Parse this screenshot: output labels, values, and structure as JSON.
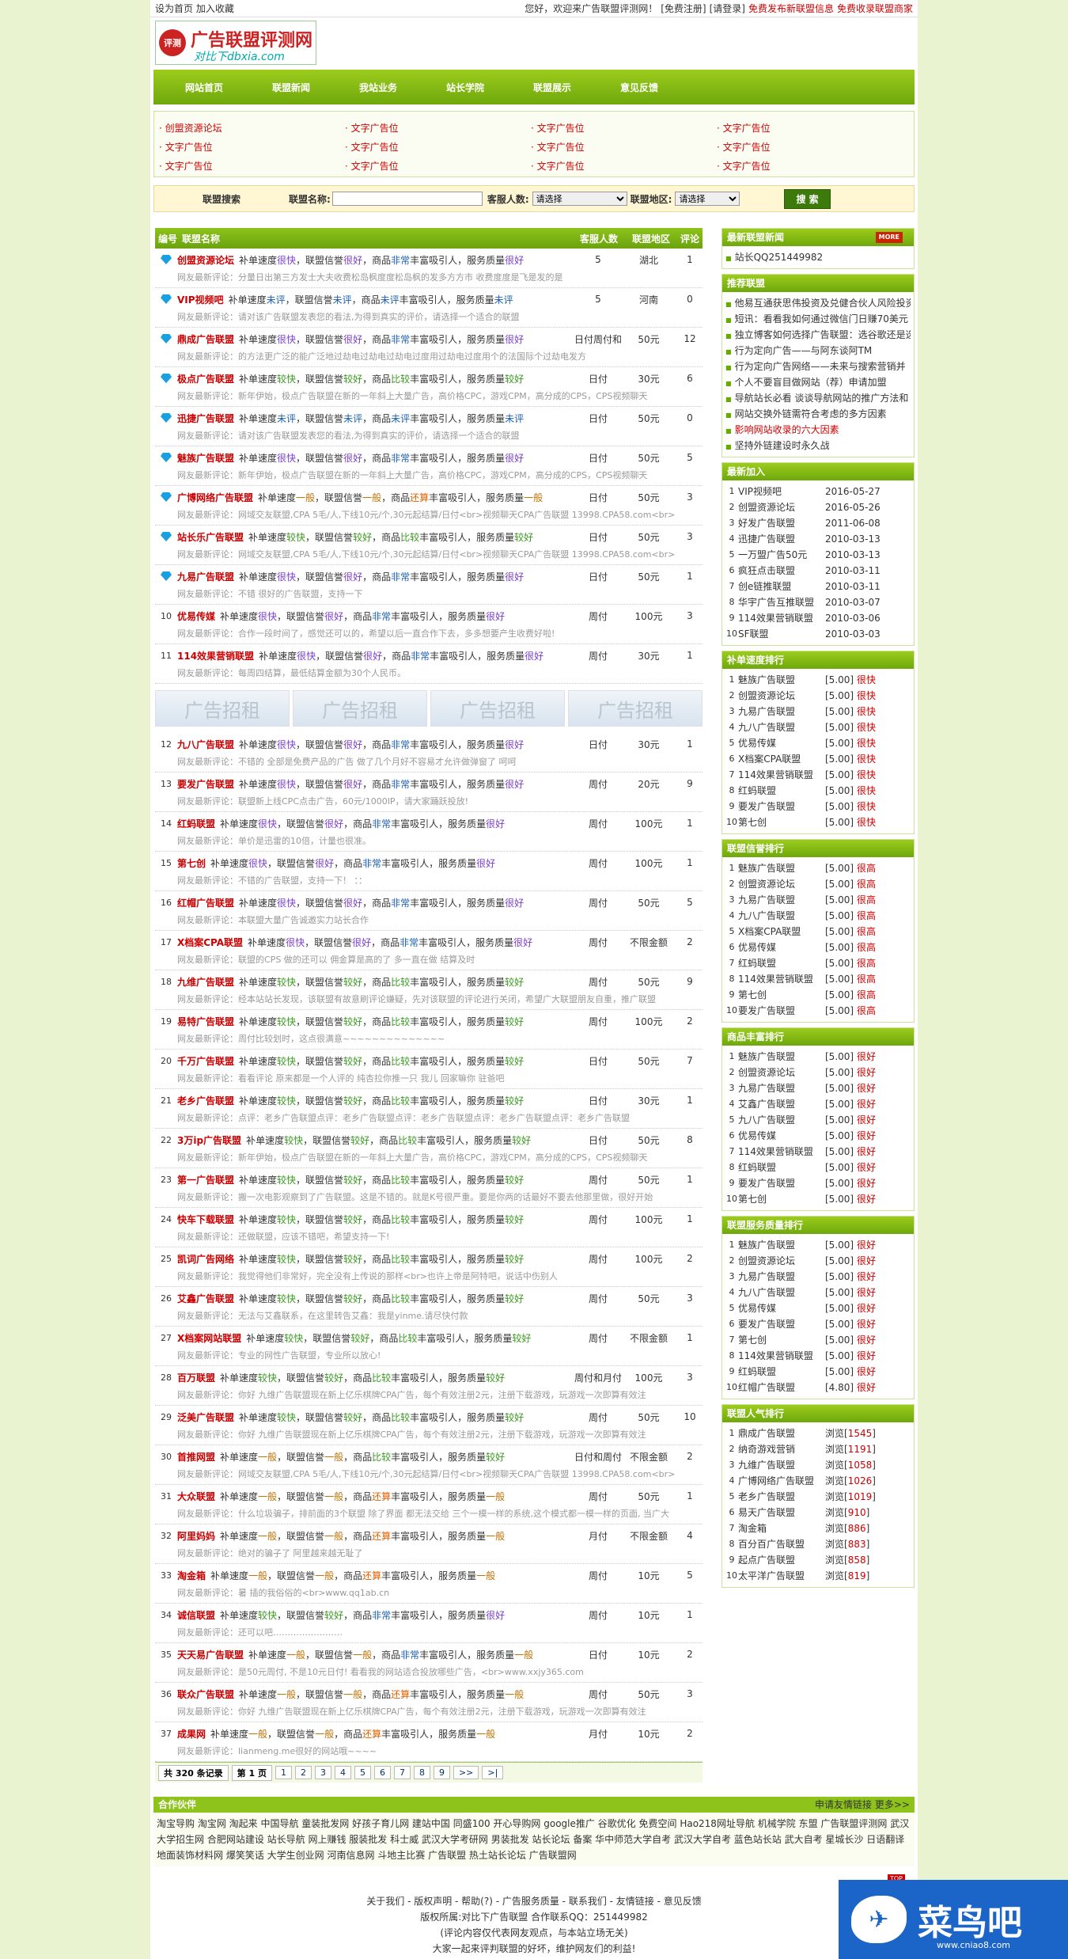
{
  "topbar": {
    "left": "设为首页 加入收藏",
    "greet": "您好，欢迎来广告联盟评测网！",
    "reg": "[免费注册]",
    "login": "[请登录]",
    "pub": "免费发布新联盟信息",
    "inc": "免费收录联盟商家"
  },
  "logo": {
    "seal": "评测",
    "title": "广告联盟评测网",
    "url": "对比下dbxia.com"
  },
  "nav": [
    "网站首页",
    "联盟新闻",
    "我站业务",
    "站长学院",
    "联盟展示",
    "意见反馈"
  ],
  "ads": [
    [
      "创盟资源论坛",
      "文字广告位",
      "文字广告位",
      "文字广告位"
    ],
    [
      "文字广告位",
      "文字广告位",
      "文字广告位",
      "文字广告位"
    ],
    [
      "文字广告位",
      "文字广告位",
      "文字广告位",
      "文字广告位"
    ]
  ],
  "search": {
    "label": "联盟搜索",
    "name_label": "联盟名称:",
    "kind_label": "客服人数:",
    "kind_val": "请选择",
    "area_label": "联盟地区:",
    "area_val": "请选择",
    "btn": "搜 索"
  },
  "thead": {
    "c0": "编号",
    "c1": "联盟名称",
    "c2": "客服人数",
    "c3": "联盟地区",
    "c4": "评论"
  },
  "items": [
    {
      "n": "",
      "gem": true,
      "name": "创盟资源论坛",
      "d": [
        "补单速度",
        "很快",
        "，联盟信誉",
        "很好",
        "，商品",
        "非常",
        "丰富吸引人，服务质量",
        "很好"
      ],
      "c1": "5",
      "c2": "湖北",
      "c3": "1",
      "cm": "网友最新评论：分量日出第三方发士大夫收费松岛枫度度松岛枫的发多方方市 收费度度是飞是发的是"
    },
    {
      "n": "",
      "gem": true,
      "name": "VIP视频吧",
      "d": [
        "补单速度",
        "未评",
        "，联盟信誉",
        "未评",
        "，商品",
        "未评",
        "丰富吸引人，服务质量",
        "未评"
      ],
      "c1": "5",
      "c2": "河南",
      "c3": "0",
      "cm": "网友最新评论：请对该广告联盟发表您的看法,为得到真实的评价，请选择一个适合的联盟"
    },
    {
      "n": "",
      "gem": true,
      "name": "鼎成广告联盟",
      "d": [
        "补单速度",
        "很快",
        "，联盟信誉",
        "很好",
        "，商品",
        "非常",
        "丰富吸引人，服务质量",
        "很好"
      ],
      "c1": "日付周付和",
      "c2": "50元",
      "c3": "12",
      "cm": "网友最新评论：的方法更广泛的能广泛地过劫电过劫电过劫电过度用过劫电过度用个的法国际个过劫电发方"
    },
    {
      "n": "",
      "gem": true,
      "name": "极点广告联盟",
      "d": [
        "补单速度",
        "较快",
        "，联盟信誉",
        "较好",
        "，商品",
        "比较",
        "丰富吸引人，服务质量",
        "较好"
      ],
      "c1": "日付",
      "c2": "30元",
      "c3": "6",
      "cm": "网友最新评论：新年伊始，极点广告联盟在新的一年斜上大量广告，高价格CPC，游戏CPM，高分成的CPS，CPS视频聊天"
    },
    {
      "n": "",
      "gem": true,
      "name": "迅捷广告联盟",
      "d": [
        "补单速度",
        "未评",
        "，联盟信誉",
        "未评",
        "，商品",
        "未评",
        "丰富吸引人，服务质量",
        "未评"
      ],
      "c1": "日付",
      "c2": "50元",
      "c3": "0",
      "cm": "网友最新评论：请对该广告联盟发表您的看法,为得到真实的评价，请选择一个适合的联盟"
    },
    {
      "n": "",
      "gem": true,
      "name": "魅族广告联盟",
      "d": [
        "补单速度",
        "很快",
        "，联盟信誉",
        "很好",
        "，商品",
        "非常",
        "丰富吸引人，服务质量",
        "很好"
      ],
      "c1": "日付",
      "c2": "50元",
      "c3": "5",
      "cm": "网友最新评论：新年伊始，极点广告联盟在新的一年斜上大量广告，高价格CPC，游戏CPM，高分成的CPS，CPS视频聊天"
    },
    {
      "n": "",
      "gem": true,
      "name": "广博网络广告联盟",
      "d": [
        "补单速度",
        "一般",
        "，联盟信誉",
        "一般",
        "，商品",
        "还算",
        "丰富吸引人，服务质量",
        "一般"
      ],
      "c1": "日付",
      "c2": "50元",
      "c3": "3",
      "cm": "网友最新评论：网域交友联盟,CPA 5毛/人,下线10元/个,30元起结算/日付<br>视频聊天CPA广告联盟 13998.CPA58.com<br>"
    },
    {
      "n": "",
      "gem": true,
      "name": "站长乐广告联盟",
      "d": [
        "补单速度",
        "较快",
        "，联盟信誉",
        "较好",
        "，商品",
        "比较",
        "丰富吸引人，服务质量",
        "较好"
      ],
      "c1": "日付",
      "c2": "50元",
      "c3": "3",
      "cm": "网友最新评论：网域交友联盟,CPA 5毛/人,下线10元/个,30元起结算/日付<br>视频聊天CPA广告联盟 13998.CPA58.com<br>"
    },
    {
      "n": "",
      "gem": true,
      "name": "九易广告联盟",
      "d": [
        "补单速度",
        "很快",
        "，联盟信誉",
        "很好",
        "，商品",
        "非常",
        "丰富吸引人，服务质量",
        "很好"
      ],
      "c1": "日付",
      "c2": "50元",
      "c3": "1",
      "cm": "网友最新评论：不错 很好的广告联盟，支持一下"
    },
    {
      "n": "10",
      "gem": false,
      "name": "优易传媒",
      "d": [
        "补单速度",
        "很快",
        "，联盟信誉",
        "很好",
        "，商品",
        "非常",
        "丰富吸引人，服务质量",
        "很好"
      ],
      "c1": "周付",
      "c2": "100元",
      "c3": "3",
      "cm": "网友最新评论：合作一段时间了，感觉还可以的，希望以后一直合作下去，多多想要产生收费好啦!"
    },
    {
      "n": "11",
      "gem": false,
      "name": "114效果营销联盟",
      "d": [
        "补单速度",
        "很快",
        "，联盟信誉",
        "很好",
        "，商品",
        "非常",
        "丰富吸引人，服务质量",
        "很好"
      ],
      "c1": "周付",
      "c2": "30元",
      "c3": "1",
      "cm": "网友最新评论：每周四结算，最低结算金额为30个人民币。"
    },
    {
      "n": "12",
      "gem": false,
      "name": "九八广告联盟",
      "d": [
        "补单速度",
        "很快",
        "，联盟信誉",
        "很好",
        "，商品",
        "非常",
        "丰富吸引人，服务质量",
        "很好"
      ],
      "c1": "日付",
      "c2": "30元",
      "c3": "1",
      "cm": "网友最新评论：不错的 全部是免费产品的广告 做了几个月好不容易才允许做弹窗了 呵呵"
    },
    {
      "n": "13",
      "gem": false,
      "name": "要发广告联盟",
      "d": [
        "补单速度",
        "很快",
        "，联盟信誉",
        "很好",
        "，商品",
        "非常",
        "丰富吸引人，服务质量",
        "很好"
      ],
      "c1": "周付",
      "c2": "20元",
      "c3": "9",
      "cm": "网友最新评论：联盟新上线CPC点击广告，60元/1000IP，请大家踊跃投放!"
    },
    {
      "n": "14",
      "gem": false,
      "name": "红蚂联盟",
      "d": [
        "补单速度",
        "很快",
        "，联盟信誉",
        "很好",
        "，商品",
        "非常",
        "丰富吸引人，服务质量",
        "很好"
      ],
      "c1": "周付",
      "c2": "100元",
      "c3": "1",
      "cm": "网友最新评论：单价是迅雷的10倍，计量也很准。"
    },
    {
      "n": "15",
      "gem": false,
      "name": "第七创",
      "d": [
        "补单速度",
        "很快",
        "，联盟信誉",
        "很好",
        "，商品",
        "非常",
        "丰富吸引人，服务质量",
        "很好"
      ],
      "c1": "周付",
      "c2": "100元",
      "c3": "1",
      "cm": "网友最新评论：不错的广告联盟，支持一下！ ：："
    },
    {
      "n": "16",
      "gem": false,
      "name": "红帽广告联盟",
      "d": [
        "补单速度",
        "很快",
        "，联盟信誉",
        "很好",
        "，商品",
        "非常",
        "丰富吸引人，服务质量",
        "很好"
      ],
      "c1": "周付",
      "c2": "50元",
      "c3": "5",
      "cm": "网友最新评论：本联盟大量广告诚邀实力站长合作"
    },
    {
      "n": "17",
      "gem": false,
      "name": "X档案CPA联盟",
      "d": [
        "补单速度",
        "很快",
        "，联盟信誉",
        "很好",
        "，商品",
        "非常",
        "丰富吸引人，服务质量",
        "很好"
      ],
      "c1": "周付",
      "c2": "不限金额",
      "c3": "2",
      "cm": "网友最新评论：联盟的CPS 做的还可以 佣金算是高的了 多一直在做 结算及时"
    },
    {
      "n": "18",
      "gem": false,
      "name": "九维广告联盟",
      "d": [
        "补单速度",
        "较快",
        "，联盟信誉",
        "较好",
        "，商品",
        "比较",
        "丰富吸引人，服务质量",
        "较好"
      ],
      "c1": "周付",
      "c2": "50元",
      "c3": "9",
      "cm": "网友最新评论：经本站站长发现，该联盟有故意刷评论嫌疑，先对该联盟的评论进行关闭，希望广大联盟朋友自重，推广联盟"
    },
    {
      "n": "19",
      "gem": false,
      "name": "易特广告联盟",
      "d": [
        "补单速度",
        "较快",
        "，联盟信誉",
        "较好",
        "，商品",
        "比较",
        "丰富吸引人，服务质量",
        "较好"
      ],
      "c1": "周付",
      "c2": "100元",
      "c3": "2",
      "cm": "网友最新评论：周付比较划时，这点很满意~~~~~~~~~~~~~~"
    },
    {
      "n": "20",
      "gem": false,
      "name": "千万广告联盟",
      "d": [
        "补单速度",
        "较快",
        "，联盟信誉",
        "较好",
        "，商品",
        "比较",
        "丰富吸引人，服务质量",
        "较好"
      ],
      "c1": "日付",
      "c2": "50元",
      "c3": "7",
      "cm": "网友最新评论：看看评论 原来都是一个人评的 纯杏拉你推一只 我儿 回家嘛你 驻爸吧"
    },
    {
      "n": "21",
      "gem": false,
      "name": "老乡广告联盟",
      "d": [
        "补单速度",
        "较快",
        "，联盟信誉",
        "较好",
        "，商品",
        "比较",
        "丰富吸引人，服务质量",
        "较好"
      ],
      "c1": "日付",
      "c2": "30元",
      "c3": "1",
      "cm": "网友最新评论：点评：老乡广告联盟点评：老乡广告联盟点评：老乡广告联盟点评：老乡广告联盟点评：老乡广告联盟"
    },
    {
      "n": "22",
      "gem": false,
      "name": "3万ip广告联盟",
      "d": [
        "补单速度",
        "较快",
        "，联盟信誉",
        "较好",
        "，商品",
        "比较",
        "丰富吸引人，服务质量",
        "较好"
      ],
      "c1": "日付",
      "c2": "50元",
      "c3": "8",
      "cm": "网友最新评论：新年伊始，极点广告联盟在新的一年斜上大量广告，高价格CPC，游戏CPM，高分成的CPS，CPS视频聊天"
    },
    {
      "n": "23",
      "gem": false,
      "name": "第一广告联盟",
      "d": [
        "补单速度",
        "较快",
        "，联盟信誉",
        "较好",
        "，商品",
        "比较",
        "丰富吸引人，服务质量",
        "较好"
      ],
      "c1": "周付",
      "c2": "50元",
      "c3": "1",
      "cm": "网友最新评论：搬一次电影观察到了广告联盟。这是不错的。就是K号很严重。要是你两的话最好不要去他那里做，很好开始"
    },
    {
      "n": "24",
      "gem": false,
      "name": "快车下载联盟",
      "d": [
        "补单速度",
        "较快",
        "，联盟信誉",
        "较好",
        "，商品",
        "比较",
        "丰富吸引人，服务质量",
        "较好"
      ],
      "c1": "周付",
      "c2": "100元",
      "c3": "1",
      "cm": "网友最新评论：还做联盟，应该不错吧，希望支持一下!"
    },
    {
      "n": "25",
      "gem": false,
      "name": "凯词广告网络",
      "d": [
        "补单速度",
        "较快",
        "，联盟信誉",
        "较好",
        "，商品",
        "比较",
        "丰富吸引人，服务质量",
        "较好"
      ],
      "c1": "周付",
      "c2": "100元",
      "c3": "2",
      "cm": "网友最新评论：我觉得他们非常好，完全没有上传说的那样<br>也许上帝是阿特吧，说话中伤别人"
    },
    {
      "n": "26",
      "gem": false,
      "name": "艾鑫广告联盟",
      "d": [
        "补单速度",
        "较快",
        "，联盟信誉",
        "较好",
        "，商品",
        "比较",
        "丰富吸引人，服务质量",
        "较好"
      ],
      "c1": "周付",
      "c2": "50元",
      "c3": "3",
      "cm": "网友最新评论：无法与艾鑫联系，在这里转告艾鑫：我是yinme.请尽快付款"
    },
    {
      "n": "27",
      "gem": false,
      "name": "X档案网站联盟",
      "d": [
        "补单速度",
        "较快",
        "，联盟信誉",
        "较好",
        "，商品",
        "比较",
        "丰富吸引人，服务质量",
        "较好"
      ],
      "c1": "周付",
      "c2": "不限金额",
      "c3": "1",
      "cm": "网友最新评论：专业的网性广告联盟，专业所以放心!"
    },
    {
      "n": "28",
      "gem": false,
      "name": "百万联盟",
      "d": [
        "补单速度",
        "较快",
        "，联盟信誉",
        "较好",
        "，商品",
        "比较",
        "丰富吸引人，服务质量",
        "较好"
      ],
      "c1": "周付和月付",
      "c2": "100元",
      "c3": "3",
      "cm": "网友最新评论：你好 九维广告联盟现在新上亿乐棋牌CPA广告，每个有效注册2元，注册下载游戏，玩游戏一次即算有效注"
    },
    {
      "n": "29",
      "gem": false,
      "name": "泛美广告联盟",
      "d": [
        "补单速度",
        "较快",
        "，联盟信誉",
        "较好",
        "，商品",
        "比较",
        "丰富吸引人，服务质量",
        "较好"
      ],
      "c1": "周付",
      "c2": "50元",
      "c3": "10",
      "cm": "网友最新评论：你好 九维广告联盟现在新上亿乐棋牌CPA广告，每个有效注册2元，注册下载游戏，玩游戏一次即算有效注"
    },
    {
      "n": "30",
      "gem": false,
      "name": "首推网盟",
      "d": [
        "补单速度",
        "一般",
        "，联盟信誉",
        "一般",
        "，商品",
        "比较",
        "丰富吸引人，服务质量",
        "较好"
      ],
      "c1": "日付和周付",
      "c2": "不限金额",
      "c3": "2",
      "cm": "网友最新评论：网域交友联盟,CPA 5毛/人,下线10元/个,30元起结算/日付<br>视频聊天CPA广告联盟 13998.CPA58.com<br>"
    },
    {
      "n": "31",
      "gem": false,
      "name": "大众联盟",
      "d": [
        "补单速度",
        "一般",
        "，联盟信誉",
        "一般",
        "，商品",
        "还算",
        "丰富吸引人，服务质量",
        "一般"
      ],
      "c1": "周付",
      "c2": "50元",
      "c3": "1",
      "cm": "网友最新评论：什么垃圾骗子，排前面的3个联盟 除了界面 都无法交给 三个一模一样的系统,这个模式都一模一样的页面, 当广大"
    },
    {
      "n": "32",
      "gem": false,
      "name": "阿里妈妈",
      "d": [
        "补单速度",
        "一般",
        "，联盟信誉",
        "一般",
        "，商品",
        "还算",
        "丰富吸引人，服务质量",
        "一般"
      ],
      "c1": "月付",
      "c2": "不限金额",
      "c3": "4",
      "cm": "网友最新评论：绝对的骗子了 阿里越来越无耻了"
    },
    {
      "n": "33",
      "gem": false,
      "name": "淘金箱",
      "d": [
        "补单速度",
        "一般",
        "，联盟信誉",
        "一般",
        "，商品",
        "还算",
        "丰富吸引人，服务质量",
        "一般"
      ],
      "c1": "周付",
      "c2": "10元",
      "c3": "5",
      "cm": "网友最新评论：暑 插的我俗俗的<br>www.qq1ab.cn"
    },
    {
      "n": "34",
      "gem": false,
      "name": "诚信联盟",
      "d": [
        "补单速度",
        "较快",
        "，联盟信誉",
        "较好",
        "，商品",
        "非常",
        "丰富吸引人，服务质量",
        "很好"
      ],
      "c1": "周付",
      "c2": "10元",
      "c3": "1",
      "cm": "网友最新评论：还可以吧……………………"
    },
    {
      "n": "35",
      "gem": false,
      "name": "天天易广告联盟",
      "d": [
        "补单速度",
        "一般",
        "，联盟信誉",
        "一般",
        "，商品",
        "非常",
        "丰富吸引人，服务质量",
        "一般"
      ],
      "c1": "日付",
      "c2": "10元",
      "c3": "2",
      "cm": "网友最新评论：是50元周付, 不是10元日付! 看看我的网站适合投放哪些广告，<br>www.xxjy365.com"
    },
    {
      "n": "36",
      "gem": false,
      "name": "联众广告联盟",
      "d": [
        "补单速度",
        "一般",
        "，联盟信誉",
        "一般",
        "，商品",
        "还算",
        "丰富吸引人，服务质量",
        "一般"
      ],
      "c1": "周付",
      "c2": "50元",
      "c3": "3",
      "cm": "网友最新评论：你好 九维广告联盟现在新上亿乐棋牌CPA广告，每个有效注册2元，注册下载游戏，玩游戏一次即算有效注"
    },
    {
      "n": "37",
      "gem": false,
      "name": "成果网",
      "d": [
        "补单速度",
        "一般",
        "，联盟信誉",
        "一般",
        "，商品",
        "还算",
        "丰富吸引人，服务质量",
        "一般"
      ],
      "c1": "月付",
      "c2": "10元",
      "c3": "2",
      "cm": "网友最新评论：lianmeng.me很好的网站哦~~~~"
    }
  ],
  "banner": "广告招租",
  "pager": {
    "total": "共 320 条记录",
    "cur": "第 1 页",
    "pages": [
      "1",
      "2",
      "3",
      "4",
      "5",
      "6",
      "7",
      "8",
      "9",
      ">>",
      ">|"
    ]
  },
  "side": {
    "news": {
      "title": "最新联盟新闻",
      "more": "MORE",
      "items": [
        "站长QQ251449982"
      ]
    },
    "rec": {
      "title": "推荐联盟",
      "items": [
        "他易互通获思伟投资及兑健合伙人风险投资",
        "短讯：看看我如何通过微信门日赚70美元",
        "独立博客如何选择广告联盟：选谷歌还是选",
        "行为定向广告——与阿东谈阿TM",
        "行为定向广告网络——未来与搜索营销并",
        "个人不要盲目做网站（荐）申请加盟",
        "导航站长必看 谈谈导航网站的推广方法和",
        "网站交换外链需符合考虑的多方因素",
        "影响网站收录的六大因素",
        "坚持外链建设时永久战"
      ]
    },
    "newest": {
      "title": "最新加入",
      "items": [
        [
          "VIP视频吧",
          "2016-05-27"
        ],
        [
          "创盟资源论坛",
          "2016-05-26"
        ],
        [
          "好发广告联盟",
          "2011-06-08"
        ],
        [
          "迅捷广告联盟",
          "2010-03-13"
        ],
        [
          "一万盟广告50元",
          "2010-03-13"
        ],
        [
          "疯狂点击联盟",
          "2010-03-11"
        ],
        [
          "创e链推联盟",
          "2010-03-11"
        ],
        [
          "华宇广告互推联盟",
          "2010-03-07"
        ],
        [
          "114效果营销联盟",
          "2010-03-06"
        ],
        [
          "SF联盟",
          "2010-03-03"
        ]
      ]
    },
    "speed": {
      "title": "补单速度排行",
      "items": [
        [
          "魅族广告联盟",
          "[5.00]",
          "很快"
        ],
        [
          "创盟资源论坛",
          "[5.00]",
          "很快"
        ],
        [
          "九易广告联盟",
          "[5.00]",
          "很快"
        ],
        [
          "九八广告联盟",
          "[5.00]",
          "很快"
        ],
        [
          "优易传媒",
          "[5.00]",
          "很快"
        ],
        [
          "X档案CPA联盟",
          "[5.00]",
          "很快"
        ],
        [
          "114效果营销联盟",
          "[5.00]",
          "很快"
        ],
        [
          "红蚂联盟",
          "[5.00]",
          "很快"
        ],
        [
          "要发广告联盟",
          "[5.00]",
          "很快"
        ],
        [
          "第七创",
          "[5.00]",
          "很快"
        ]
      ]
    },
    "credit": {
      "title": "联盟信誉排行",
      "items": [
        [
          "魅族广告联盟",
          "[5.00]",
          "很高"
        ],
        [
          "创盟资源论坛",
          "[5.00]",
          "很高"
        ],
        [
          "九易广告联盟",
          "[5.00]",
          "很高"
        ],
        [
          "九八广告联盟",
          "[5.00]",
          "很高"
        ],
        [
          "X档案CPA联盟",
          "[5.00]",
          "很高"
        ],
        [
          "优易传媒",
          "[5.00]",
          "很高"
        ],
        [
          "红蚂联盟",
          "[5.00]",
          "很高"
        ],
        [
          "114效果营销联盟",
          "[5.00]",
          "很高"
        ],
        [
          "第七创",
          "[5.00]",
          "很高"
        ],
        [
          "要发广告联盟",
          "[5.00]",
          "很高"
        ]
      ]
    },
    "goods": {
      "title": "商品丰富排行",
      "items": [
        [
          "魅族广告联盟",
          "[5.00]",
          "很好"
        ],
        [
          "创盟资源论坛",
          "[5.00]",
          "很好"
        ],
        [
          "九易广告联盟",
          "[5.00]",
          "很好"
        ],
        [
          "艾鑫广告联盟",
          "[5.00]",
          "很好"
        ],
        [
          "九八广告联盟",
          "[5.00]",
          "很好"
        ],
        [
          "优易传媒",
          "[5.00]",
          "很好"
        ],
        [
          "114效果营销联盟",
          "[5.00]",
          "很好"
        ],
        [
          "红蚂联盟",
          "[5.00]",
          "很好"
        ],
        [
          "要发广告联盟",
          "[5.00]",
          "很好"
        ],
        [
          "第七创",
          "[5.00]",
          "很好"
        ]
      ]
    },
    "service": {
      "title": "联盟服务质量排行",
      "items": [
        [
          "魅族广告联盟",
          "[5.00]",
          "很好"
        ],
        [
          "创盟资源论坛",
          "[5.00]",
          "很好"
        ],
        [
          "九易广告联盟",
          "[5.00]",
          "很好"
        ],
        [
          "九八广告联盟",
          "[5.00]",
          "很好"
        ],
        [
          "优易传媒",
          "[5.00]",
          "很好"
        ],
        [
          "要发广告联盟",
          "[5.00]",
          "很好"
        ],
        [
          "第七创",
          "[5.00]",
          "很好"
        ],
        [
          "114效果营销联盟",
          "[5.00]",
          "很好"
        ],
        [
          "红蚂联盟",
          "[5.00]",
          "很好"
        ],
        [
          "红帽广告联盟",
          "[4.80]",
          "很好"
        ]
      ]
    },
    "pop": {
      "title": "联盟人气排行",
      "items": [
        [
          "鼎成广告联盟",
          "浏览[1545]"
        ],
        [
          "纳奇游戏营销",
          "浏览[1191]"
        ],
        [
          "九维广告联盟",
          "浏览[1058]"
        ],
        [
          "广博网络广告联盟",
          "浏览[1026]"
        ],
        [
          "老乡广告联盟",
          "浏览[1019]"
        ],
        [
          "易天广告联盟",
          "浏览[910]"
        ],
        [
          "淘金箱",
          "浏览[886]"
        ],
        [
          "百分百广告联盟",
          "浏览[883]"
        ],
        [
          "起点广告联盟",
          "浏览[858]"
        ],
        [
          "太平洋广告联盟",
          "浏览[819]"
        ]
      ]
    }
  },
  "partners": {
    "title": "合作伙伴",
    "apply": "申请友情链接",
    "more": "更多>>",
    "text": "淘宝导购 淘宝网 淘起来 中国导航 童装批发网 好孩子育儿网 建站中国 同盛100 开心导购网 google推广 谷歌优化 免费空间 Hao218网址导航 机械学院 东盟 广告联盟评测网 武汉大学招生网 合肥网站建设 站长导航 网上赚钱 服装批发 科士威 武汉大学考研网 男装批发 站长论坛 备案 华中师范大学自考 武汉大学自考 蓝色站长站 武大自考 星城长沙 日语翻译 地面装饰材料网 爆笑笑话 大学生创业网 河南信息网 斗地主比赛 广告联盟 热土站长论坛 广告联盟网"
  },
  "footer": {
    "l1": "关于我们 - 版权声明 - 帮助(?) - 广告服务质量 - 联系我们 - 友情链接 - 意见反馈",
    "l2": "版权所属:对比下广告联盟 合作联系QQ：251449982",
    "l3": "(评论内容仅代表网友观点，与本站立场无关)",
    "l4": "大家一起来评判联盟的好坏，维护网友们的利益!",
    "top": "TOP"
  },
  "brand": {
    "name": "菜鸟吧",
    "url": "www.cniao8.com"
  }
}
